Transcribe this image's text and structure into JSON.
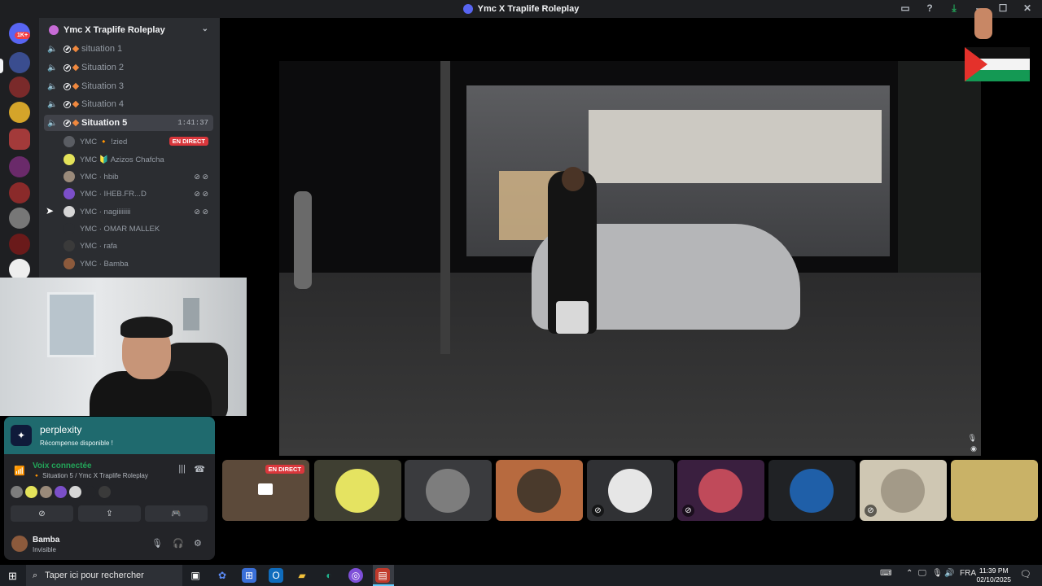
{
  "window": {
    "title": "Ymc X Traplife Roleplay"
  },
  "rail": {
    "badge": "1K+"
  },
  "guild": {
    "name": "Ymc X Traplife Roleplay"
  },
  "channels": [
    {
      "name": "situation 1"
    },
    {
      "name": "Situation 2"
    },
    {
      "name": "Situation 3"
    },
    {
      "name": "Situation 4"
    },
    {
      "name": "Situation 5",
      "timer": "1:41:37"
    }
  ],
  "members": [
    {
      "name": "YMC 🔸 !zied",
      "live": "EN DIRECT",
      "color": "#5a5d63"
    },
    {
      "name": "YMC 🔰 Azizos Chafcha",
      "color": "#e4e35a"
    },
    {
      "name": "YMC · hbib",
      "color": "#9a8a7a"
    },
    {
      "name": "YMC · IHEB.FR...D",
      "color": "#7b4fc9"
    },
    {
      "name": "YMC · nagiiiiiiii",
      "color": "#d6d6d6"
    },
    {
      "name": "YMC · OMAR MALLEK",
      "color": "#2b2d31"
    },
    {
      "name": "YMC · rafa",
      "color": "#3a3a3a"
    },
    {
      "name": "YMC · Bamba",
      "color": "#8c5a3c"
    }
  ],
  "promo": {
    "name": "perplexity",
    "subtitle": "Récompense disponible !"
  },
  "voice": {
    "status": "Voix connectée",
    "channel": "🔸 Situation 5 / Ymc X Traplife Roleplay"
  },
  "user": {
    "name": "Bamba",
    "status": "Invisible"
  },
  "tiles": [
    {
      "live": "EN DIRECT",
      "bg": "#5c4a3a"
    },
    {
      "bg": "#3f3f32",
      "av": "#e5e361"
    },
    {
      "bg": "#3a3b3e",
      "av": "#7d7d7d"
    },
    {
      "bg": "#b76a3f",
      "av": "#4a3a2c"
    },
    {
      "bg": "#303134",
      "av": "#e6e6e6"
    },
    {
      "bg": "#3a1f3f",
      "av": "#c04a5a"
    },
    {
      "bg": "#202225",
      "av": "#1f5fa8"
    },
    {
      "bg": "#cfc7b3",
      "av": "#a39a88"
    },
    {
      "bg": "#c9b267",
      "av": "#b8553a"
    }
  ],
  "taskbar": {
    "search_placeholder": "Taper ici pour rechercher",
    "lang": "FRA",
    "time": "11:39 PM",
    "date": "02/10/2025"
  }
}
